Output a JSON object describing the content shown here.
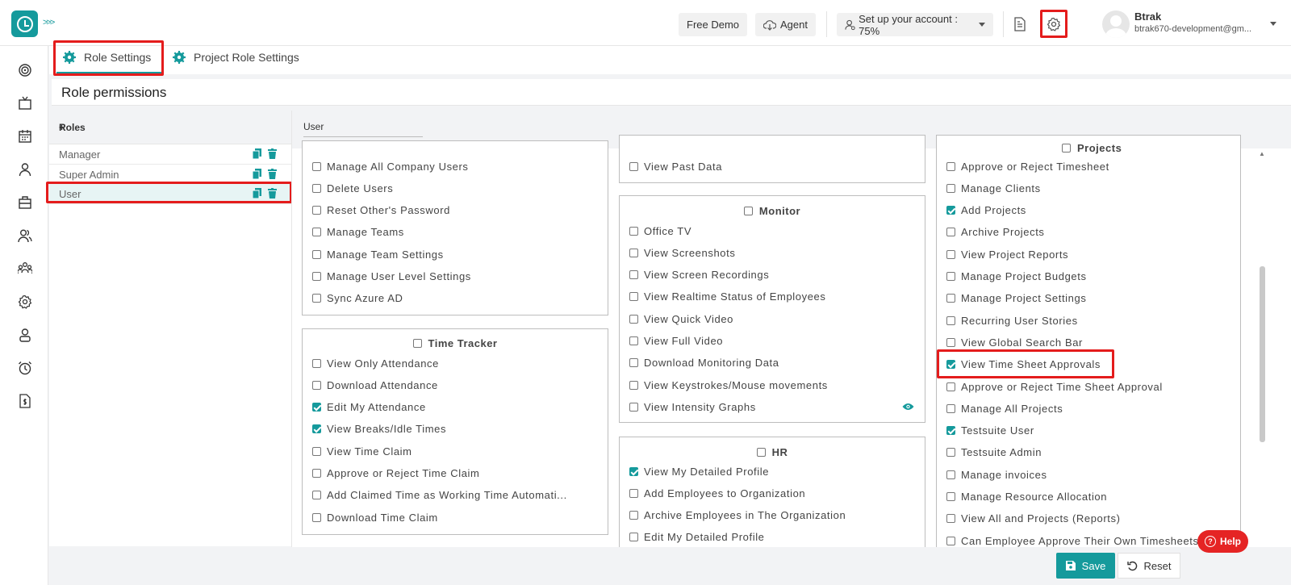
{
  "header": {
    "free_demo": "Free Demo",
    "agent": "Agent",
    "setup": "Set up your account : 75%",
    "user_name": "Btrak",
    "user_email": "btrak670-development@gm..."
  },
  "tabs": [
    {
      "label": "Role Settings"
    },
    {
      "label": "Project Role Settings"
    }
  ],
  "page_title": "Role permissions",
  "roles": {
    "heading": "Roles",
    "items": [
      {
        "label": "Manager"
      },
      {
        "label": "Super Admin"
      },
      {
        "label": "User"
      }
    ],
    "selected": "User"
  },
  "role_name_value": "User",
  "cards": {
    "users": {
      "items": [
        {
          "label": "Manage All Company Users",
          "checked": false
        },
        {
          "label": "Delete Users",
          "checked": false
        },
        {
          "label": "Reset Other's Password",
          "checked": false
        },
        {
          "label": "Manage Teams",
          "checked": false
        },
        {
          "label": "Manage Team Settings",
          "checked": false
        },
        {
          "label": "Manage User Level Settings",
          "checked": false
        },
        {
          "label": "Sync Azure AD",
          "checked": false
        }
      ]
    },
    "time_tracker": {
      "title": "Time Tracker",
      "items": [
        {
          "label": "View Only Attendance",
          "checked": false
        },
        {
          "label": "Download Attendance",
          "checked": false
        },
        {
          "label": "Edit My Attendance",
          "checked": true
        },
        {
          "label": "View Breaks/Idle Times",
          "checked": true
        },
        {
          "label": "View Time Claim",
          "checked": false
        },
        {
          "label": "Approve or Reject Time Claim",
          "checked": false
        },
        {
          "label": "Add Claimed Time as Working Time Automati...",
          "checked": false
        },
        {
          "label": "Download Time Claim",
          "checked": false
        }
      ]
    },
    "past": {
      "items": [
        {
          "label": "View Past Data",
          "checked": false
        }
      ]
    },
    "monitor": {
      "title": "Monitor",
      "items": [
        {
          "label": "Office TV",
          "checked": false
        },
        {
          "label": "View Screenshots",
          "checked": false
        },
        {
          "label": "View Screen Recordings",
          "checked": false
        },
        {
          "label": "View Realtime Status of Employees",
          "checked": false
        },
        {
          "label": "View Quick Video",
          "checked": false
        },
        {
          "label": "View Full Video",
          "checked": false
        },
        {
          "label": "Download Monitoring Data",
          "checked": false
        },
        {
          "label": "View Keystrokes/Mouse movements",
          "checked": false
        },
        {
          "label": "View Intensity Graphs",
          "checked": false
        }
      ]
    },
    "hr": {
      "title": "HR",
      "items": [
        {
          "label": "View My Detailed Profile",
          "checked": true
        },
        {
          "label": "Add Employees to Organization",
          "checked": false
        },
        {
          "label": "Archive Employees in The Organization",
          "checked": false
        },
        {
          "label": "Edit My Detailed Profile",
          "checked": false
        }
      ]
    },
    "projects": {
      "title": "Projects",
      "items": [
        {
          "label": "Approve or Reject Timesheet",
          "checked": false
        },
        {
          "label": "Manage Clients",
          "checked": false
        },
        {
          "label": "Add Projects",
          "checked": true
        },
        {
          "label": "Archive Projects",
          "checked": false
        },
        {
          "label": "View Project Reports",
          "checked": false
        },
        {
          "label": "Manage Project Budgets",
          "checked": false
        },
        {
          "label": "Manage Project Settings",
          "checked": false
        },
        {
          "label": "Recurring User Stories",
          "checked": false
        },
        {
          "label": "View Global Search Bar",
          "checked": false
        },
        {
          "label": "View Time Sheet Approvals",
          "checked": true
        },
        {
          "label": "Approve or Reject Time Sheet Approval",
          "checked": false
        },
        {
          "label": "Manage All Projects",
          "checked": false
        },
        {
          "label": "Testsuite User",
          "checked": true
        },
        {
          "label": "Testsuite Admin",
          "checked": false
        },
        {
          "label": "Manage invoices",
          "checked": false
        },
        {
          "label": "Manage Resource Allocation",
          "checked": false
        },
        {
          "label": "View All and Projects (Reports)",
          "checked": false
        },
        {
          "label": "Can Employee Approve Their Own Timesheets",
          "checked": false
        }
      ]
    }
  },
  "buttons": {
    "save": "Save",
    "reset": "Reset",
    "help": "Help"
  },
  "colors": {
    "accent": "#159a9c",
    "highlight": "#e41c1c"
  }
}
